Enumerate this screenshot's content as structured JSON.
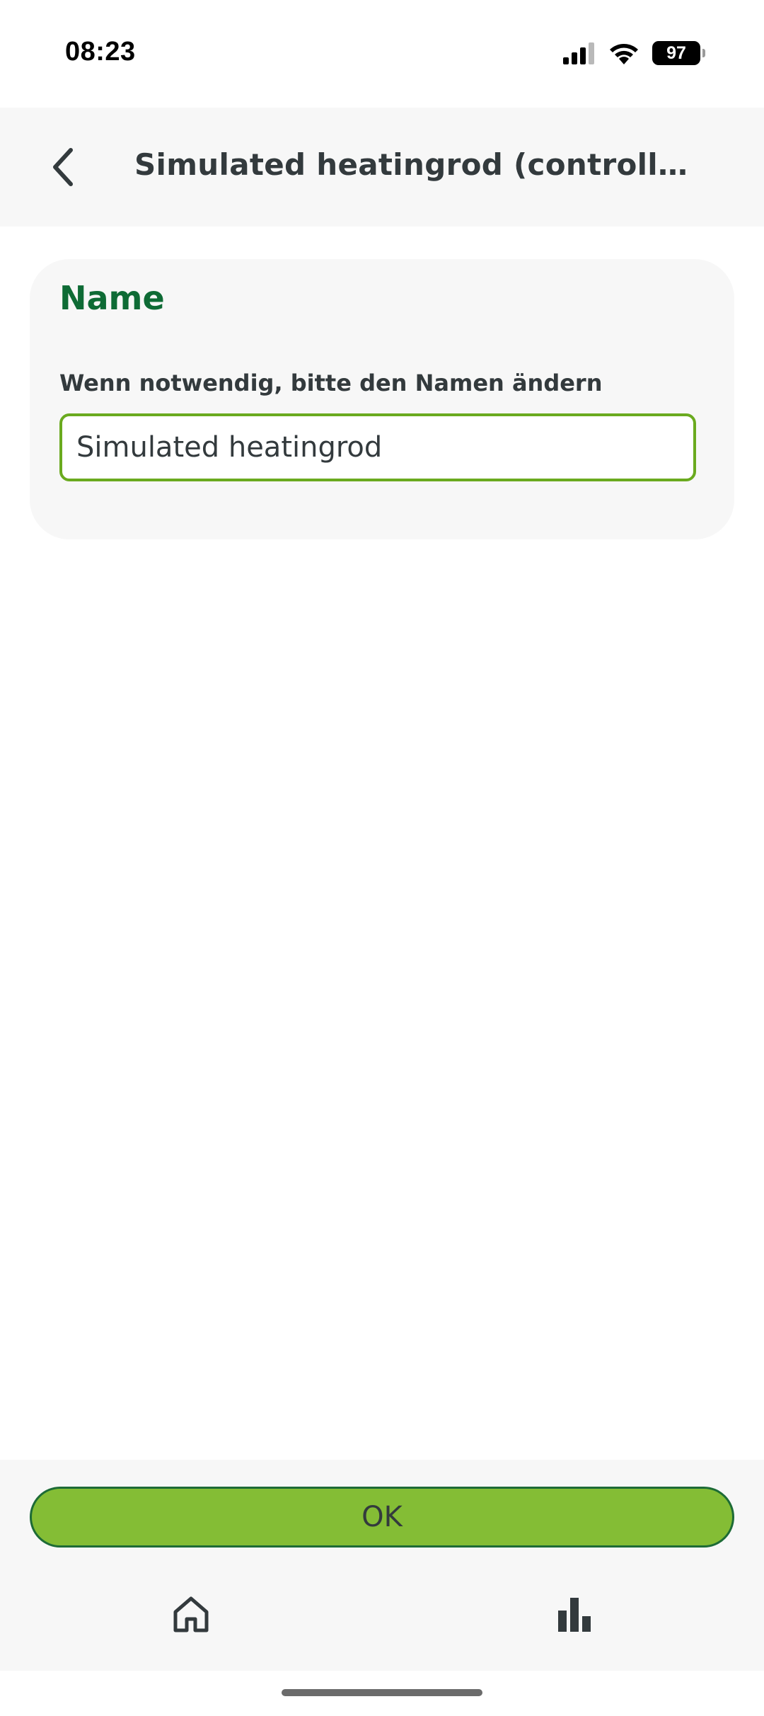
{
  "status_bar": {
    "time": "08:23",
    "battery_level": "97",
    "signal_icon": "cellular-signal-icon",
    "wifi_icon": "wifi-icon"
  },
  "header": {
    "back_icon": "chevron-left-icon",
    "title": "Simulated heatingrod (controllable)"
  },
  "card": {
    "title": "Name",
    "field_label": "Wenn notwendig, bitte den Namen ändern",
    "name_value": "Simulated heatingrod"
  },
  "actions": {
    "ok_label": "OK"
  },
  "bottom_nav": {
    "items": [
      {
        "icon": "home-icon"
      },
      {
        "icon": "bar-chart-icon"
      }
    ]
  },
  "colors": {
    "accent_green": "#84bd35",
    "title_green": "#0e6b35",
    "input_border": "#6aaa1f",
    "text_dark": "#333a3d",
    "panel_bg": "#f7f7f7"
  }
}
